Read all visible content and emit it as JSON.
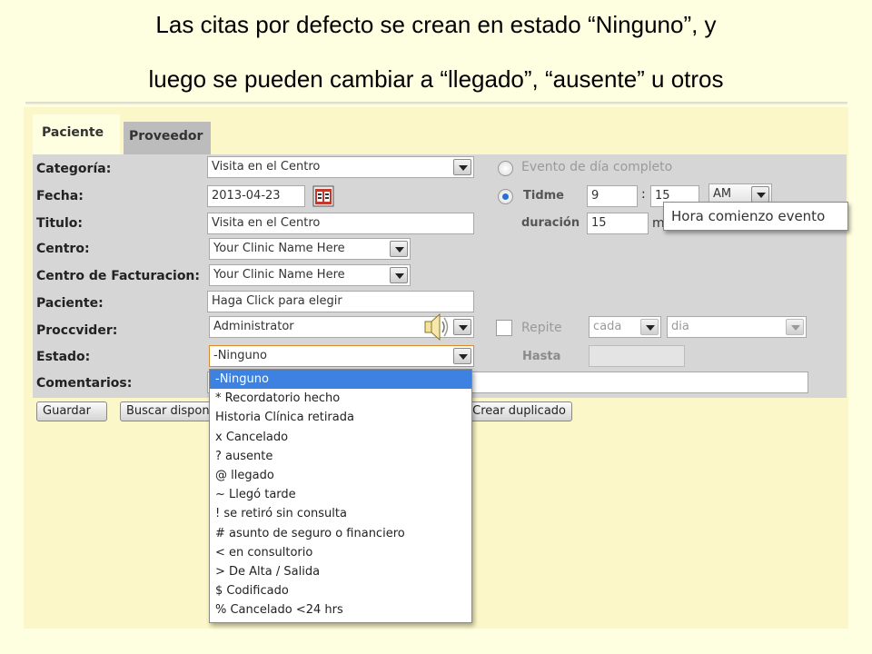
{
  "slide": {
    "title_line1": "Las citas por defecto se crean en estado “Ninguno”, y",
    "title_line2": "luego se pueden cambiar a “llegado”, “ausente” u otros"
  },
  "tabs": {
    "active": "Paciente",
    "inactive": "Proveedor"
  },
  "form": {
    "labels": {
      "categoria": "Categoría:",
      "fecha": "Fecha:",
      "titulo": "Titulo:",
      "centro": "Centro:",
      "centro_facturacion": "Centro de Facturacion:",
      "paciente": "Paciente:",
      "proveedor": "Proccvider:",
      "estado": "Estado:",
      "comentarios": "Comentarios:"
    },
    "values": {
      "categoria": "Visita en el Centro",
      "fecha": "2013-04-23",
      "titulo": "Visita en el Centro",
      "centro": "Your Clinic Name Here",
      "centro_facturacion": "Your Clinic Name Here",
      "paciente": "Haga Click para elegir",
      "proveedor": "Administrator",
      "estado": "-Ninguno",
      "comentarios": ""
    },
    "right": {
      "evento_dia_completo": "Evento de día completo",
      "tiempo_label": "Tidme",
      "hora": "9",
      "time_sep": ":",
      "minutos": "15",
      "ampm": "AM",
      "duracion_label": "duración",
      "duracion": "15",
      "duracion_unit": "m",
      "repite_label": "Repite",
      "repite_cada": "cada",
      "repite_unidad": "dia",
      "hasta_label": "Hasta",
      "hasta_value": ""
    },
    "tooltip": "Hora comienzo evento"
  },
  "buttons": {
    "guardar": "Guardar",
    "buscar": "Buscar disponible",
    "crear_duplicado": "Crear duplicado"
  },
  "estado_options": [
    "-Ninguno",
    "* Recordatorio hecho",
    "Historia Clínica retirada",
    "x Cancelado",
    "? ausente",
    "@ llegado",
    "~ Llegó tarde",
    "! se retiró sin consulta",
    "# asunto de seguro o financiero",
    "< en consultorio",
    "> De Alta / Salida",
    "$ Codificado",
    "% Cancelado <24 hrs"
  ],
  "estado_selected_index": 0,
  "icons": {
    "calendar": "calendar-icon",
    "speaker": "speaker-icon"
  },
  "colors": {
    "slide_background": "#fefee0",
    "form_background": "#d6d6d6",
    "selected_option": "#3d82e0"
  }
}
